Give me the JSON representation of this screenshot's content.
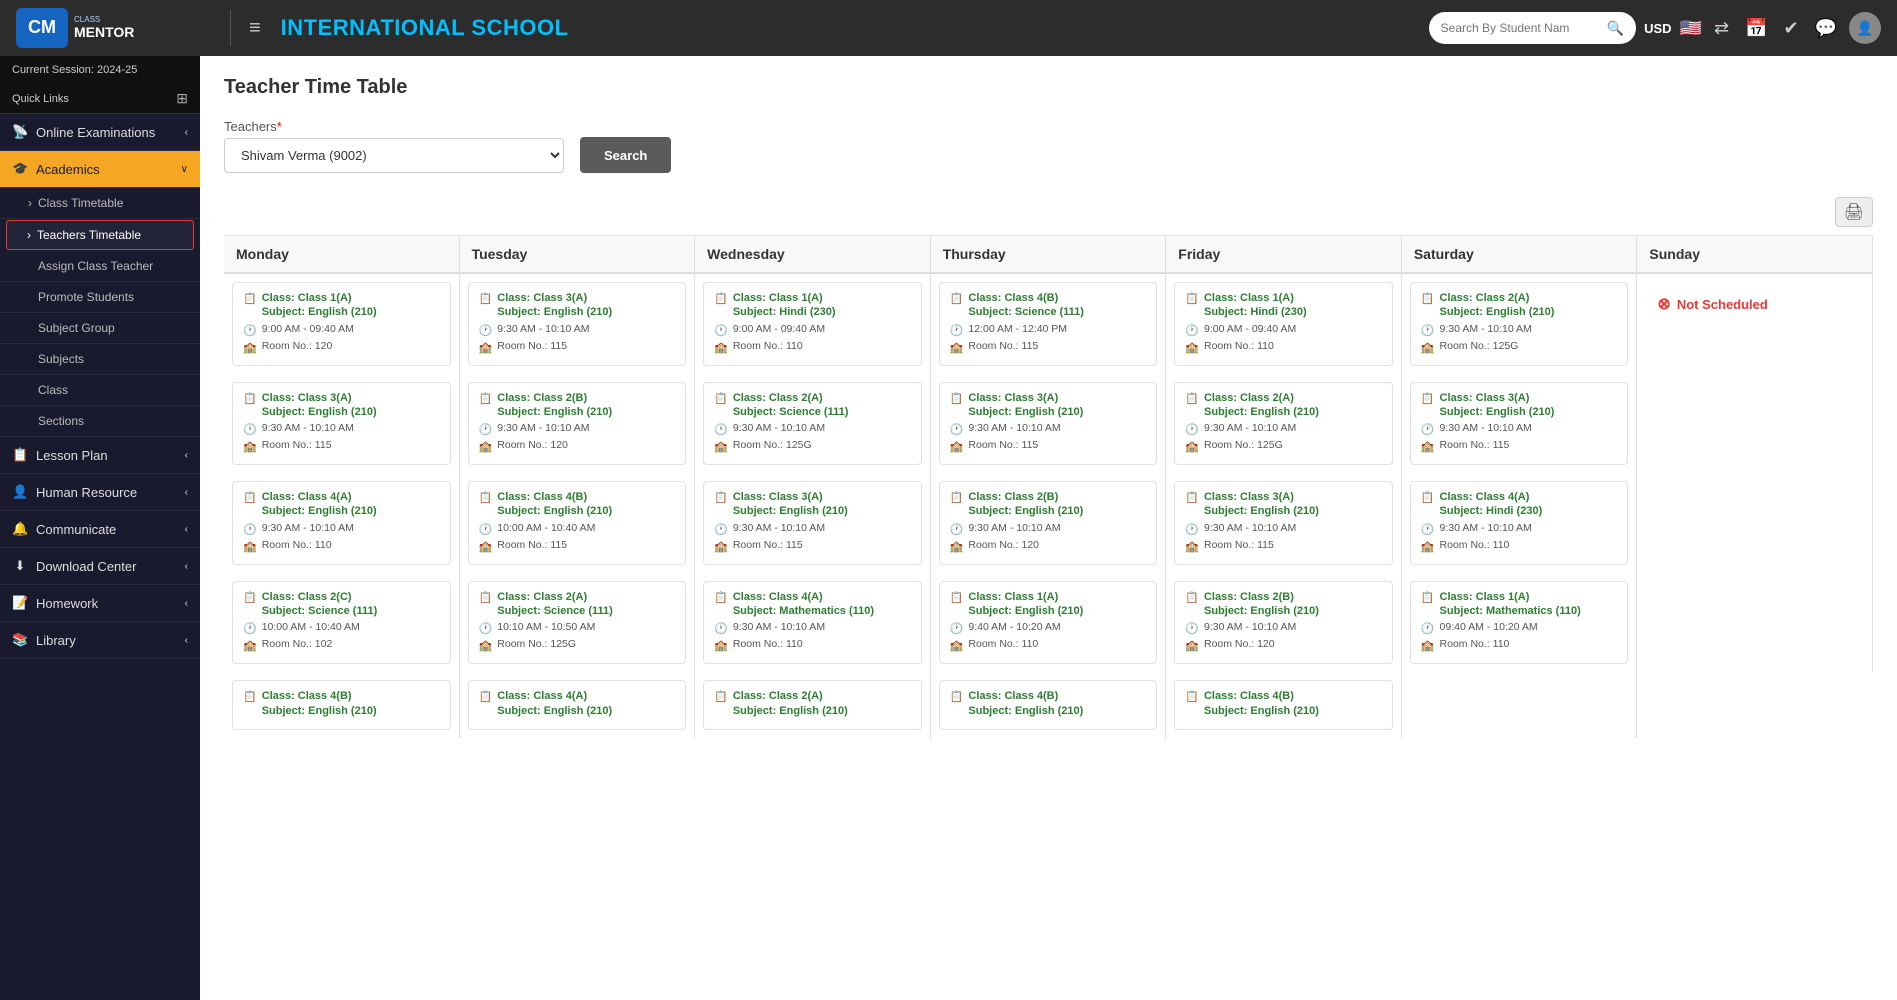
{
  "header": {
    "school_name": "INTERNATIONAL SCHOOL",
    "search_placeholder": "Search By Student Nam",
    "currency": "USD",
    "hamburger": "≡",
    "logo_cm": "CM",
    "logo_sub": "CLASS\nMENTOR"
  },
  "sidebar": {
    "session": "Current Session: 2024-25",
    "quick_links": "Quick Links",
    "items": [
      {
        "id": "online-exam",
        "label": "Online Examinations",
        "icon": "📡",
        "arrow": "‹",
        "active": false
      },
      {
        "id": "academics",
        "label": "Academics",
        "icon": "🎓",
        "arrow": "∨",
        "active": true
      },
      {
        "id": "class-timetable",
        "label": "Class Timetable",
        "sub": true,
        "arrow": "›"
      },
      {
        "id": "teachers-timetable",
        "label": "Teachers Timetable",
        "sub": true,
        "highlighted": true
      },
      {
        "id": "assign-class-teacher",
        "label": "Assign Class Teacher",
        "sub": true
      },
      {
        "id": "promote-students",
        "label": "Promote Students",
        "sub": true
      },
      {
        "id": "subject-group",
        "label": "Subject Group",
        "sub": true
      },
      {
        "id": "subjects",
        "label": "Subjects",
        "sub": true
      },
      {
        "id": "class",
        "label": "Class",
        "sub": true
      },
      {
        "id": "sections",
        "label": "Sections",
        "sub": true
      },
      {
        "id": "lesson-plan",
        "label": "Lesson Plan",
        "icon": "📋",
        "arrow": "‹",
        "active": false
      },
      {
        "id": "human-resource",
        "label": "Human Resource",
        "icon": "👤",
        "arrow": "‹",
        "active": false
      },
      {
        "id": "communicate",
        "label": "Communicate",
        "icon": "🔔",
        "arrow": "‹",
        "active": false
      },
      {
        "id": "download-center",
        "label": "Download Center",
        "icon": "⬇",
        "arrow": "‹",
        "active": false
      },
      {
        "id": "homework",
        "label": "Homework",
        "icon": "📝",
        "arrow": "‹",
        "active": false
      },
      {
        "id": "library",
        "label": "Library",
        "icon": "📚",
        "arrow": "‹",
        "active": false
      }
    ]
  },
  "page": {
    "title": "Teacher Time Table",
    "teacher_label": "Teachers",
    "teacher_required": "*",
    "teacher_selected": "Shivam Verma (9002)",
    "search_btn": "Search"
  },
  "timetable": {
    "days": [
      "Monday",
      "Tuesday",
      "Wednesday",
      "Thursday",
      "Friday",
      "Saturday",
      "Sunday"
    ],
    "columns": [
      {
        "day": "Monday",
        "cards": [
          {
            "class": "Class: Class 1(A)",
            "subject": "Subject: English (210)",
            "time": "9:00 AM - 09:40 AM",
            "room": "Room No.: 120"
          },
          {
            "class": "Class: Class 3(A)",
            "subject": "Subject: English (210)",
            "time": "9:30 AM - 10:10 AM",
            "room": "Room No.: 115"
          },
          {
            "class": "Class: Class 4(A)",
            "subject": "Subject: English (210)",
            "time": "9:30 AM - 10:10 AM",
            "room": "Room No.: 110"
          },
          {
            "class": "Class: Class 2(C)",
            "subject": "Subject: Science (111)",
            "time": "10:00 AM - 10:40 AM",
            "room": "Room No.: 102"
          },
          {
            "class": "Class: Class 4(B)",
            "subject": "Subject: English (210)",
            "time": "",
            "room": ""
          }
        ]
      },
      {
        "day": "Tuesday",
        "cards": [
          {
            "class": "Class: Class 3(A)",
            "subject": "Subject: English (210)",
            "time": "9:30 AM - 10:10 AM",
            "room": "Room No.: 115"
          },
          {
            "class": "Class: Class 2(B)",
            "subject": "Subject: English (210)",
            "time": "9:30 AM - 10:10 AM",
            "room": "Room No.: 120"
          },
          {
            "class": "Class: Class 4(B)",
            "subject": "Subject: English (210)",
            "time": "10:00 AM - 10:40 AM",
            "room": "Room No.: 115"
          },
          {
            "class": "Class: Class 2(A)",
            "subject": "Subject: Science (111)",
            "time": "10:10 AM - 10:50 AM",
            "room": "Room No.: 125G"
          },
          {
            "class": "Class: Class 4(A)",
            "subject": "Subject: English (210)",
            "time": "",
            "room": ""
          }
        ]
      },
      {
        "day": "Wednesday",
        "cards": [
          {
            "class": "Class: Class 1(A)",
            "subject": "Subject: Hindi (230)",
            "time": "9:00 AM - 09:40 AM",
            "room": "Room No.: 110"
          },
          {
            "class": "Class: Class 2(A)",
            "subject": "Subject: Science (111)",
            "time": "9:30 AM - 10:10 AM",
            "room": "Room No.: 125G"
          },
          {
            "class": "Class: Class 3(A)",
            "subject": "Subject: English (210)",
            "time": "9:30 AM - 10:10 AM",
            "room": "Room No.: 115"
          },
          {
            "class": "Class: Class 4(A)",
            "subject": "Subject: Mathematics (110)",
            "time": "9:30 AM - 10:10 AM",
            "room": "Room No.: 110"
          },
          {
            "class": "Class: Class 2(A)",
            "subject": "Subject: English (210)",
            "time": "",
            "room": ""
          }
        ]
      },
      {
        "day": "Thursday",
        "cards": [
          {
            "class": "Class: Class 4(B)",
            "subject": "Subject: Science (111)",
            "time": "12:00 AM - 12:40 PM",
            "room": "Room No.: 115"
          },
          {
            "class": "Class: Class 3(A)",
            "subject": "Subject: English (210)",
            "time": "9:30 AM - 10:10 AM",
            "room": "Room No.: 115"
          },
          {
            "class": "Class: Class 2(B)",
            "subject": "Subject: English (210)",
            "time": "9:30 AM - 10:10 AM",
            "room": "Room No.: 120"
          },
          {
            "class": "Class: Class 1(A)",
            "subject": "Subject: English (210)",
            "time": "9:40 AM - 10:20 AM",
            "room": "Room No.: 110"
          },
          {
            "class": "Class: Class 4(B)",
            "subject": "Subject: English (210)",
            "time": "",
            "room": ""
          }
        ]
      },
      {
        "day": "Friday",
        "cards": [
          {
            "class": "Class: Class 1(A)",
            "subject": "Subject: Hindi (230)",
            "time": "9:00 AM - 09:40 AM",
            "room": "Room No.: 110"
          },
          {
            "class": "Class: Class 2(A)",
            "subject": "Subject: English (210)",
            "time": "9:30 AM - 10:10 AM",
            "room": "Room No.: 125G"
          },
          {
            "class": "Class: Class 3(A)",
            "subject": "Subject: English (210)",
            "time": "9:30 AM - 10:10 AM",
            "room": "Room No.: 115"
          },
          {
            "class": "Class: Class 2(B)",
            "subject": "Subject: English (210)",
            "time": "9:30 AM - 10:10 AM",
            "room": "Room No.: 120"
          },
          {
            "class": "Class: Class 4(B)",
            "subject": "Subject: English (210)",
            "time": "",
            "room": ""
          }
        ]
      },
      {
        "day": "Saturday",
        "cards": [
          {
            "class": "Class: Class 2(A)",
            "subject": "Subject: English (210)",
            "time": "9:30 AM - 10:10 AM",
            "room": "Room No.: 125G"
          },
          {
            "class": "Class: Class 3(A)",
            "subject": "Subject: English (210)",
            "time": "9:30 AM - 10:10 AM",
            "room": "Room No.: 115"
          },
          {
            "class": "Class: Class 4(A)",
            "subject": "Subject: Hindi (230)",
            "time": "9:30 AM - 10:10 AM",
            "room": "Room No.: 110"
          },
          {
            "class": "Class: Class 1(A)",
            "subject": "Subject: Mathematics (110)",
            "time": "09:40 AM - 10:20 AM",
            "room": "Room No.: 110"
          }
        ]
      },
      {
        "day": "Sunday",
        "not_scheduled": true,
        "not_scheduled_label": "Not Scheduled",
        "cards": []
      }
    ]
  }
}
